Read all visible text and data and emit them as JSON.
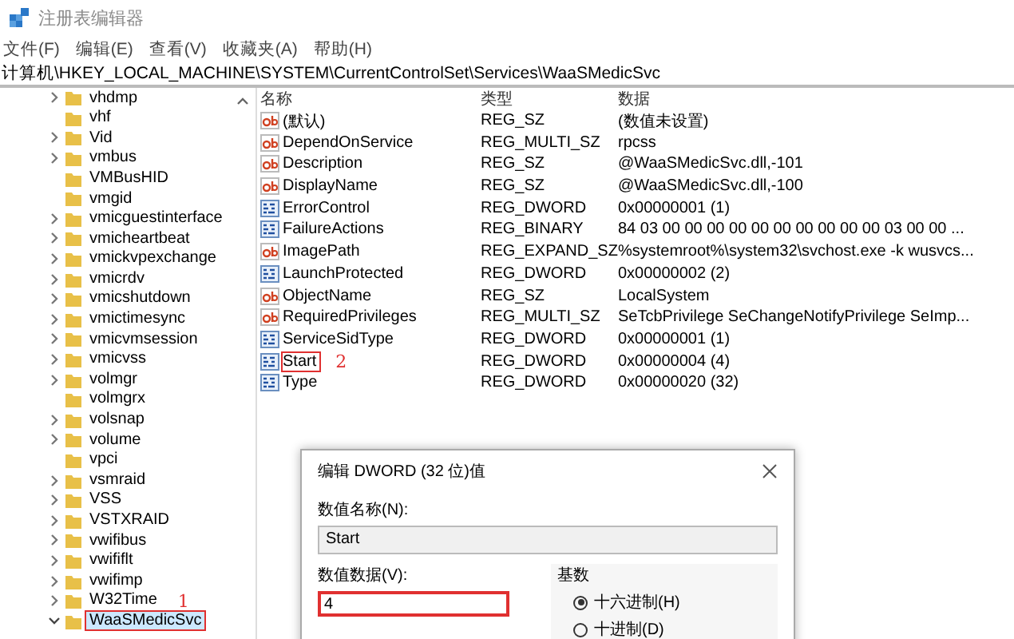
{
  "window": {
    "title": "注册表编辑器"
  },
  "menu": [
    "文件(F)",
    "编辑(E)",
    "查看(V)",
    "收藏夹(A)",
    "帮助(H)"
  ],
  "address": "计算机\\HKEY_LOCAL_MACHINE\\SYSTEM\\CurrentControlSet\\Services\\WaaSMedicSvc",
  "tree": [
    {
      "label": "vhdmp",
      "has_children": true,
      "expanded": false,
      "selected": false
    },
    {
      "label": "vhf",
      "has_children": false,
      "selected": false
    },
    {
      "label": "Vid",
      "has_children": true,
      "expanded": false,
      "selected": false
    },
    {
      "label": "vmbus",
      "has_children": true,
      "expanded": false,
      "selected": false
    },
    {
      "label": "VMBusHID",
      "has_children": false,
      "selected": false
    },
    {
      "label": "vmgid",
      "has_children": false,
      "selected": false
    },
    {
      "label": "vmicguestinterface",
      "has_children": true,
      "expanded": false,
      "selected": false
    },
    {
      "label": "vmicheartbeat",
      "has_children": true,
      "expanded": false,
      "selected": false
    },
    {
      "label": "vmickvpexchange",
      "has_children": true,
      "expanded": false,
      "selected": false
    },
    {
      "label": "vmicrdv",
      "has_children": true,
      "expanded": false,
      "selected": false
    },
    {
      "label": "vmicshutdown",
      "has_children": true,
      "expanded": false,
      "selected": false
    },
    {
      "label": "vmictimesync",
      "has_children": true,
      "expanded": false,
      "selected": false
    },
    {
      "label": "vmicvmsession",
      "has_children": true,
      "expanded": false,
      "selected": false
    },
    {
      "label": "vmicvss",
      "has_children": true,
      "expanded": false,
      "selected": false
    },
    {
      "label": "volmgr",
      "has_children": true,
      "expanded": false,
      "selected": false
    },
    {
      "label": "volmgrx",
      "has_children": false,
      "selected": false
    },
    {
      "label": "volsnap",
      "has_children": true,
      "expanded": false,
      "selected": false
    },
    {
      "label": "volume",
      "has_children": true,
      "expanded": false,
      "selected": false
    },
    {
      "label": "vpci",
      "has_children": false,
      "selected": false
    },
    {
      "label": "vsmraid",
      "has_children": true,
      "expanded": false,
      "selected": false
    },
    {
      "label": "VSS",
      "has_children": true,
      "expanded": false,
      "selected": false
    },
    {
      "label": "VSTXRAID",
      "has_children": true,
      "expanded": false,
      "selected": false
    },
    {
      "label": "vwifibus",
      "has_children": true,
      "expanded": false,
      "selected": false
    },
    {
      "label": "vwififlt",
      "has_children": true,
      "expanded": false,
      "selected": false
    },
    {
      "label": "vwifimp",
      "has_children": true,
      "expanded": false,
      "selected": false
    },
    {
      "label": "W32Time",
      "has_children": true,
      "expanded": false,
      "selected": false,
      "marker": "1"
    },
    {
      "label": "WaaSMedicSvc",
      "has_children": true,
      "expanded": true,
      "selected": true,
      "outlined": true
    }
  ],
  "columns": [
    "名称",
    "类型",
    "数据"
  ],
  "values": [
    {
      "kind": "string",
      "name": "(默认)",
      "type": "REG_SZ",
      "data": "(数值未设置)",
      "outlined": false
    },
    {
      "kind": "string",
      "name": "DependOnService",
      "type": "REG_MULTI_SZ",
      "data": "rpcss",
      "outlined": false
    },
    {
      "kind": "string",
      "name": "Description",
      "type": "REG_SZ",
      "data": "@WaaSMedicSvc.dll,-101",
      "outlined": false
    },
    {
      "kind": "string",
      "name": "DisplayName",
      "type": "REG_SZ",
      "data": "@WaaSMedicSvc.dll,-100",
      "outlined": false
    },
    {
      "kind": "binary",
      "name": "ErrorControl",
      "type": "REG_DWORD",
      "data": "0x00000001 (1)",
      "outlined": false
    },
    {
      "kind": "binary",
      "name": "FailureActions",
      "type": "REG_BINARY",
      "data": "84 03 00 00 00 00 00 00 00 00 00 00 03 00 00 ...",
      "outlined": false
    },
    {
      "kind": "string",
      "name": "ImagePath",
      "type": "REG_EXPAND_SZ",
      "data": "%systemroot%\\system32\\svchost.exe -k wusvcs...",
      "outlined": false
    },
    {
      "kind": "binary",
      "name": "LaunchProtected",
      "type": "REG_DWORD",
      "data": "0x00000002 (2)",
      "outlined": false
    },
    {
      "kind": "string",
      "name": "ObjectName",
      "type": "REG_SZ",
      "data": "LocalSystem",
      "outlined": false
    },
    {
      "kind": "string",
      "name": "RequiredPrivileges",
      "type": "REG_MULTI_SZ",
      "data": "SeTcbPrivilege SeChangeNotifyPrivilege SeImp...",
      "outlined": false
    },
    {
      "kind": "binary",
      "name": "ServiceSidType",
      "type": "REG_DWORD",
      "data": "0x00000001 (1)",
      "outlined": false
    },
    {
      "kind": "binary",
      "name": "Start",
      "type": "REG_DWORD",
      "data": "0x00000004 (4)",
      "outlined": true,
      "marker": "2"
    },
    {
      "kind": "binary",
      "name": "Type",
      "type": "REG_DWORD",
      "data": "0x00000020 (32)",
      "outlined": false
    }
  ],
  "dialog": {
    "title": "编辑 DWORD (32 位)值",
    "name_label": "数值名称(N):",
    "name_value": "Start",
    "data_label": "数值数据(V):",
    "data_value": "4",
    "data_outlined": true,
    "base_label": "基数",
    "bases": [
      {
        "label": "十六进制(H)",
        "selected": true
      },
      {
        "label": "十进制(D)",
        "selected": false
      }
    ]
  }
}
